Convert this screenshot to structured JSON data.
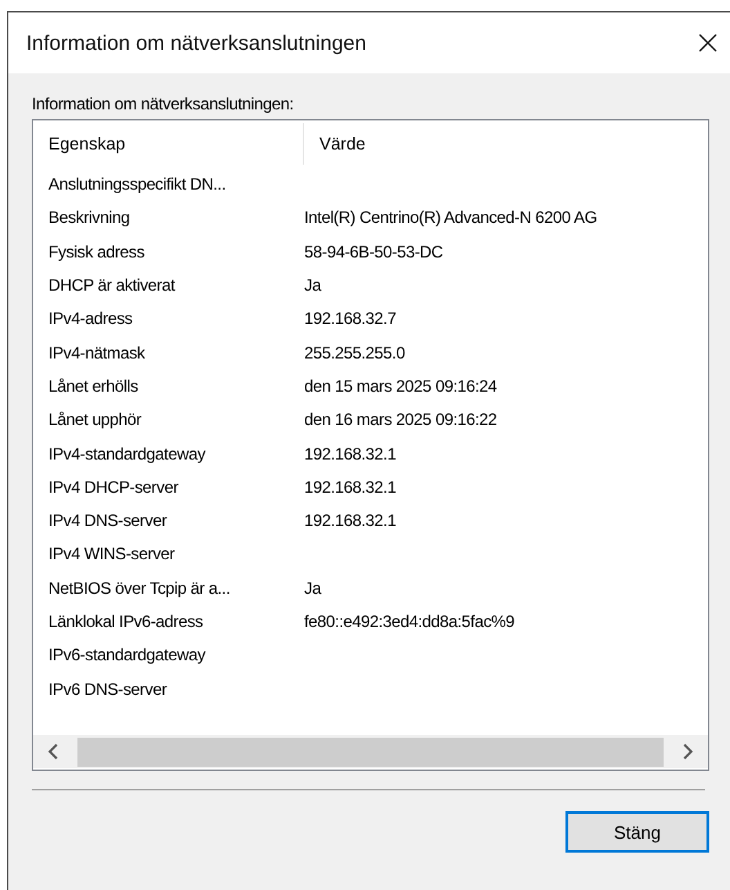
{
  "window": {
    "title": "Information om nätverksanslutningen"
  },
  "label": "Information om nätverksanslutningen:",
  "table": {
    "columns": [
      "Egenskap",
      "Värde"
    ],
    "rows": [
      {
        "property": "Anslutningsspecifikt DN..."
      },
      {
        "property": "Beskrivning",
        "value": "Intel(R) Centrino(R) Advanced-N 6200 AG"
      },
      {
        "property": "Fysisk adress",
        "value": "58-94-6B-50-53-DC"
      },
      {
        "property": "DHCP är aktiverat",
        "value": "Ja"
      },
      {
        "property": "IPv4-adress",
        "value": "192.168.32.7"
      },
      {
        "property": "IPv4-nätmask",
        "value": "255.255.255.0"
      },
      {
        "property": "Lånet erhölls",
        "value": "den 15 mars 2025 09:16:24"
      },
      {
        "property": "Lånet upphör",
        "value": "den 16 mars 2025 09:16:22"
      },
      {
        "property": "IPv4-standardgateway",
        "value": "192.168.32.1"
      },
      {
        "property": "IPv4 DHCP-server",
        "value": "192.168.32.1"
      },
      {
        "property": "IPv4 DNS-server",
        "value": "192.168.32.1"
      },
      {
        "property": "IPv4 WINS-server"
      },
      {
        "property": "NetBIOS över Tcpip är a...",
        "value": "Ja"
      },
      {
        "property": "Länklokal IPv6-adress",
        "value": "fe80::e492:3ed4:dd8a:5fac%9"
      },
      {
        "property": "IPv6-standardgateway"
      },
      {
        "property": "IPv6 DNS-server"
      }
    ]
  },
  "buttons": [
    {
      "label": "Stäng",
      "focused": true
    }
  ]
}
